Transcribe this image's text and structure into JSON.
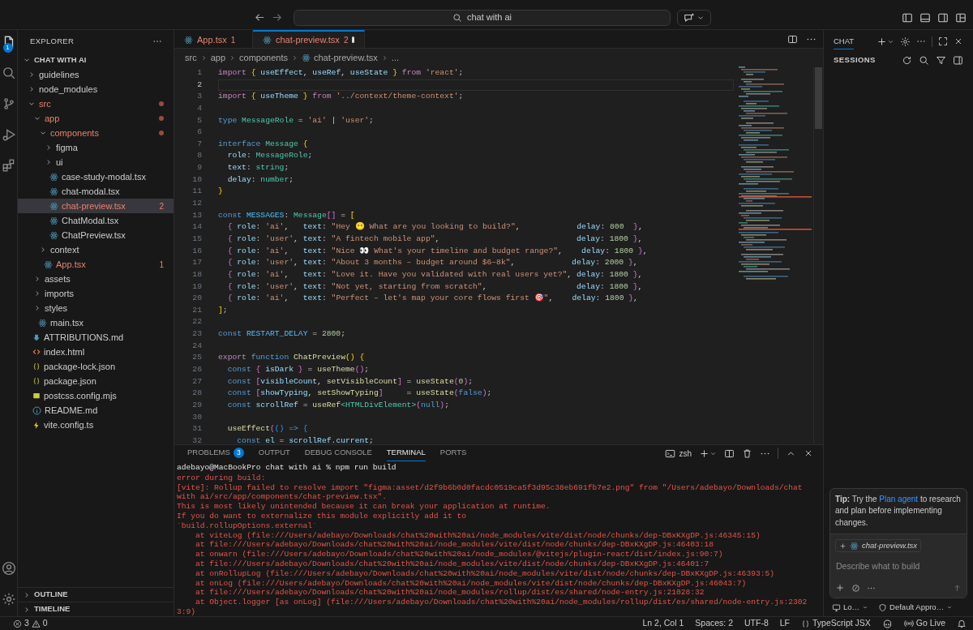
{
  "title_bar": {
    "search": "chat with ai"
  },
  "activity_bar": {
    "explorer_badge": "1"
  },
  "explorer": {
    "title": "EXPLORER",
    "root": "CHAT WITH AI",
    "items": [
      {
        "name": "guidelines",
        "kind": "folder",
        "expanded": false,
        "selected": false,
        "error": false
      },
      {
        "name": "node_modules",
        "kind": "folder",
        "expanded": false,
        "selected": false,
        "error": false
      },
      {
        "name": "src",
        "kind": "folder",
        "expanded": true,
        "selected": false,
        "error": true,
        "children": [
          {
            "name": "app",
            "kind": "folder",
            "expanded": true,
            "selected": false,
            "error": true,
            "children": [
              {
                "name": "components",
                "kind": "folder",
                "expanded": true,
                "selected": false,
                "error": true,
                "children": [
                  {
                    "name": "figma",
                    "kind": "folder",
                    "expanded": false,
                    "selected": false,
                    "error": false
                  },
                  {
                    "name": "ui",
                    "kind": "folder",
                    "expanded": false,
                    "selected": false,
                    "error": false
                  },
                  {
                    "name": "case-study-modal.tsx",
                    "kind": "react",
                    "selected": false,
                    "error": false
                  },
                  {
                    "name": "chat-modal.tsx",
                    "kind": "react",
                    "selected": false,
                    "error": false
                  },
                  {
                    "name": "chat-preview.tsx",
                    "kind": "react",
                    "selected": true,
                    "error": true,
                    "badge": "2"
                  },
                  {
                    "name": "ChatModal.tsx",
                    "kind": "react",
                    "selected": false,
                    "error": false
                  },
                  {
                    "name": "ChatPreview.tsx",
                    "kind": "react",
                    "selected": false,
                    "error": false
                  }
                ]
              },
              {
                "name": "context",
                "kind": "folder",
                "expanded": false,
                "selected": false,
                "error": false
              },
              {
                "name": "App.tsx",
                "kind": "react",
                "selected": false,
                "error": true,
                "badge": "1"
              }
            ]
          },
          {
            "name": "assets",
            "kind": "folder",
            "expanded": false,
            "selected": false,
            "error": false
          },
          {
            "name": "imports",
            "kind": "folder",
            "expanded": false,
            "selected": false,
            "error": false
          },
          {
            "name": "styles",
            "kind": "folder",
            "expanded": false,
            "selected": false,
            "error": false
          },
          {
            "name": "main.tsx",
            "kind": "react",
            "selected": false,
            "error": false
          }
        ]
      },
      {
        "name": "ATTRIBUTIONS.md",
        "kind": "markdown",
        "selected": false,
        "error": false
      },
      {
        "name": "index.html",
        "kind": "html",
        "selected": false,
        "error": false
      },
      {
        "name": "package-lock.json",
        "kind": "json",
        "selected": false,
        "error": false
      },
      {
        "name": "package.json",
        "kind": "json",
        "selected": false,
        "error": false
      },
      {
        "name": "postcss.config.mjs",
        "kind": "js",
        "selected": false,
        "error": false
      },
      {
        "name": "README.md",
        "kind": "info",
        "selected": false,
        "error": false
      },
      {
        "name": "vite.config.ts",
        "kind": "vite",
        "selected": false,
        "error": false
      }
    ],
    "sections": [
      "OUTLINE",
      "TIMELINE"
    ]
  },
  "tabs": [
    {
      "label": "App.tsx",
      "badge": "1",
      "error": true,
      "selected": false,
      "dirty": false
    },
    {
      "label": "chat-preview.tsx",
      "badge": "2",
      "error": true,
      "selected": true,
      "dirty": true
    }
  ],
  "breadcrumb": [
    {
      "label": "src",
      "kind": "folder"
    },
    {
      "label": "app",
      "kind": "folder"
    },
    {
      "label": "components",
      "kind": "folder"
    },
    {
      "label": "chat-preview.tsx",
      "kind": "react"
    },
    {
      "label": "...",
      "kind": "more"
    }
  ],
  "code": {
    "lines": [
      {
        "number": "1",
        "current": false,
        "tokens": [
          {
            "text": "import ",
            "kind": "kw"
          },
          {
            "text": "{",
            "kind": "b1"
          },
          {
            "text": " useEffect",
            "kind": "var"
          },
          {
            "text": ", ",
            "kind": "p"
          },
          {
            "text": "useRef",
            "kind": "var"
          },
          {
            "text": ", ",
            "kind": "p"
          },
          {
            "text": "useState",
            "kind": "var"
          },
          {
            "text": " }",
            "kind": "b1"
          },
          {
            "text": " from ",
            "kind": "kw"
          },
          {
            "text": "'react'",
            "kind": "str"
          },
          {
            "text": ";",
            "kind": "p"
          }
        ]
      },
      {
        "number": "2",
        "current": true
      },
      {
        "number": "3",
        "current": false,
        "tokens": [
          {
            "text": "import ",
            "kind": "kw"
          },
          {
            "text": "{",
            "kind": "b1"
          },
          {
            "text": " useTheme ",
            "kind": "var"
          },
          {
            "text": "}",
            "kind": "b1"
          },
          {
            "text": " from ",
            "kind": "kw"
          },
          {
            "text": "'../context/theme-context'",
            "kind": "str"
          },
          {
            "text": ";",
            "kind": "p"
          }
        ]
      },
      {
        "number": "4",
        "current": false
      },
      {
        "number": "5",
        "current": false,
        "tokens": [
          {
            "text": "type ",
            "kind": "decl"
          },
          {
            "text": "MessageRole",
            "kind": "type"
          },
          {
            "text": " = ",
            "kind": "p"
          },
          {
            "text": "'ai'",
            "kind": "str"
          },
          {
            "text": " | ",
            "kind": "p"
          },
          {
            "text": "'user'",
            "kind": "str"
          },
          {
            "text": ";",
            "kind": "p"
          }
        ]
      },
      {
        "number": "6",
        "current": false
      },
      {
        "number": "7",
        "current": false,
        "tokens": [
          {
            "text": "interface ",
            "kind": "decl"
          },
          {
            "text": "Message ",
            "kind": "type"
          },
          {
            "text": "{",
            "kind": "b1"
          }
        ]
      },
      {
        "number": "8",
        "current": false,
        "tokens": [
          {
            "text": "  role",
            "kind": "var"
          },
          {
            "text": ": ",
            "kind": "p"
          },
          {
            "text": "MessageRole",
            "kind": "type"
          },
          {
            "text": ";",
            "kind": "p"
          }
        ]
      },
      {
        "number": "9",
        "current": false,
        "tokens": [
          {
            "text": "  text",
            "kind": "var"
          },
          {
            "text": ": ",
            "kind": "p"
          },
          {
            "text": "string",
            "kind": "type"
          },
          {
            "text": ";",
            "kind": "p"
          }
        ]
      },
      {
        "number": "10",
        "current": false,
        "tokens": [
          {
            "text": "  delay",
            "kind": "var"
          },
          {
            "text": ": ",
            "kind": "p"
          },
          {
            "text": "number",
            "kind": "type"
          },
          {
            "text": ";",
            "kind": "p"
          }
        ]
      },
      {
        "number": "11",
        "current": false,
        "tokens": [
          {
            "text": "}",
            "kind": "b1"
          }
        ]
      },
      {
        "number": "12",
        "current": false
      },
      {
        "number": "13",
        "current": false,
        "tokens": [
          {
            "text": "const ",
            "kind": "decl"
          },
          {
            "text": "MESSAGES",
            "kind": "const"
          },
          {
            "text": ": ",
            "kind": "p"
          },
          {
            "text": "Message",
            "kind": "type"
          },
          {
            "text": "[]",
            "kind": "b2"
          },
          {
            "text": " = ",
            "kind": "p"
          },
          {
            "text": "[",
            "kind": "b1"
          }
        ]
      },
      {
        "number": "14",
        "current": false,
        "tokens": [
          {
            "text": "  {",
            "kind": "b2"
          },
          {
            "text": " role",
            "kind": "var"
          },
          {
            "text": ": ",
            "kind": "p"
          },
          {
            "text": "'ai'",
            "kind": "str"
          },
          {
            "text": ",   ",
            "kind": "p"
          },
          {
            "text": "text",
            "kind": "var"
          },
          {
            "text": ": ",
            "kind": "p"
          },
          {
            "text": "\"Hey 😶 What are you looking to build?\"",
            "kind": "str"
          },
          {
            "text": ",            ",
            "kind": "p"
          },
          {
            "text": "delay",
            "kind": "var"
          },
          {
            "text": ": ",
            "kind": "p"
          },
          {
            "text": "800",
            "kind": "num"
          },
          {
            "text": "  }",
            "kind": "b2"
          },
          {
            "text": ",",
            "kind": "p"
          }
        ]
      },
      {
        "number": "15",
        "current": false,
        "tokens": [
          {
            "text": "  {",
            "kind": "b2"
          },
          {
            "text": " role",
            "kind": "var"
          },
          {
            "text": ": ",
            "kind": "p"
          },
          {
            "text": "'user'",
            "kind": "str"
          },
          {
            "text": ", ",
            "kind": "p"
          },
          {
            "text": "text",
            "kind": "var"
          },
          {
            "text": ": ",
            "kind": "p"
          },
          {
            "text": "\"A fintech mobile app\"",
            "kind": "str"
          },
          {
            "text": ",                             ",
            "kind": "p"
          },
          {
            "text": "delay",
            "kind": "var"
          },
          {
            "text": ": ",
            "kind": "p"
          },
          {
            "text": "1800",
            "kind": "num"
          },
          {
            "text": " }",
            "kind": "b2"
          },
          {
            "text": ",",
            "kind": "p"
          }
        ]
      },
      {
        "number": "16",
        "current": false,
        "tokens": [
          {
            "text": "  {",
            "kind": "b2"
          },
          {
            "text": " role",
            "kind": "var"
          },
          {
            "text": ": ",
            "kind": "p"
          },
          {
            "text": "'ai'",
            "kind": "str"
          },
          {
            "text": ",   ",
            "kind": "p"
          },
          {
            "text": "text",
            "kind": "var"
          },
          {
            "text": ": ",
            "kind": "p"
          },
          {
            "text": "\"Nice 👀 What's your timeline and budget range?\"",
            "kind": "str"
          },
          {
            "text": ",    ",
            "kind": "p"
          },
          {
            "text": "delay",
            "kind": "var"
          },
          {
            "text": ": ",
            "kind": "p"
          },
          {
            "text": "1800",
            "kind": "num"
          },
          {
            "text": " }",
            "kind": "b2"
          },
          {
            "text": ",",
            "kind": "p"
          }
        ]
      },
      {
        "number": "17",
        "current": false,
        "tokens": [
          {
            "text": "  {",
            "kind": "b2"
          },
          {
            "text": " role",
            "kind": "var"
          },
          {
            "text": ": ",
            "kind": "p"
          },
          {
            "text": "'user'",
            "kind": "str"
          },
          {
            "text": ", ",
            "kind": "p"
          },
          {
            "text": "text",
            "kind": "var"
          },
          {
            "text": ": ",
            "kind": "p"
          },
          {
            "text": "\"About 3 months – budget around $6–8k\"",
            "kind": "str"
          },
          {
            "text": ",            ",
            "kind": "p"
          },
          {
            "text": "delay",
            "kind": "var"
          },
          {
            "text": ": ",
            "kind": "p"
          },
          {
            "text": "2000",
            "kind": "num"
          },
          {
            "text": " }",
            "kind": "b2"
          },
          {
            "text": ",",
            "kind": "p"
          }
        ]
      },
      {
        "number": "18",
        "current": false,
        "tokens": [
          {
            "text": "  {",
            "kind": "b2"
          },
          {
            "text": " role",
            "kind": "var"
          },
          {
            "text": ": ",
            "kind": "p"
          },
          {
            "text": "'ai'",
            "kind": "str"
          },
          {
            "text": ",   ",
            "kind": "p"
          },
          {
            "text": "text",
            "kind": "var"
          },
          {
            "text": ": ",
            "kind": "p"
          },
          {
            "text": "\"Love it. Have you validated with real users yet?\"",
            "kind": "str"
          },
          {
            "text": ", ",
            "kind": "p"
          },
          {
            "text": "delay",
            "kind": "var"
          },
          {
            "text": ": ",
            "kind": "p"
          },
          {
            "text": "1800",
            "kind": "num"
          },
          {
            "text": " }",
            "kind": "b2"
          },
          {
            "text": ",",
            "kind": "p"
          }
        ]
      },
      {
        "number": "19",
        "current": false,
        "tokens": [
          {
            "text": "  {",
            "kind": "b2"
          },
          {
            "text": " role",
            "kind": "var"
          },
          {
            "text": ": ",
            "kind": "p"
          },
          {
            "text": "'user'",
            "kind": "str"
          },
          {
            "text": ", ",
            "kind": "p"
          },
          {
            "text": "text",
            "kind": "var"
          },
          {
            "text": ": ",
            "kind": "p"
          },
          {
            "text": "\"Not yet, starting from scratch\"",
            "kind": "str"
          },
          {
            "text": ",                   ",
            "kind": "p"
          },
          {
            "text": "delay",
            "kind": "var"
          },
          {
            "text": ": ",
            "kind": "p"
          },
          {
            "text": "1800",
            "kind": "num"
          },
          {
            "text": " }",
            "kind": "b2"
          },
          {
            "text": ",",
            "kind": "p"
          }
        ]
      },
      {
        "number": "20",
        "current": false,
        "tokens": [
          {
            "text": "  {",
            "kind": "b2"
          },
          {
            "text": " role",
            "kind": "var"
          },
          {
            "text": ": ",
            "kind": "p"
          },
          {
            "text": "'ai'",
            "kind": "str"
          },
          {
            "text": ",   ",
            "kind": "p"
          },
          {
            "text": "text",
            "kind": "var"
          },
          {
            "text": ": ",
            "kind": "p"
          },
          {
            "text": "\"Perfect – let's map your core flows first 🎯\"",
            "kind": "str"
          },
          {
            "text": ",    ",
            "kind": "p"
          },
          {
            "text": "delay",
            "kind": "var"
          },
          {
            "text": ": ",
            "kind": "p"
          },
          {
            "text": "1800",
            "kind": "num"
          },
          {
            "text": " }",
            "kind": "b2"
          },
          {
            "text": ",",
            "kind": "p"
          }
        ]
      },
      {
        "number": "21",
        "current": false,
        "tokens": [
          {
            "text": "]",
            "kind": "b1"
          },
          {
            "text": ";",
            "kind": "p"
          }
        ]
      },
      {
        "number": "22",
        "current": false
      },
      {
        "number": "23",
        "current": false,
        "tokens": [
          {
            "text": "const ",
            "kind": "decl"
          },
          {
            "text": "RESTART_DELAY",
            "kind": "const"
          },
          {
            "text": " = ",
            "kind": "p"
          },
          {
            "text": "2800",
            "kind": "num"
          },
          {
            "text": ";",
            "kind": "p"
          }
        ]
      },
      {
        "number": "24",
        "current": false
      },
      {
        "number": "25",
        "current": false,
        "tokens": [
          {
            "text": "export ",
            "kind": "kw"
          },
          {
            "text": "function ",
            "kind": "decl"
          },
          {
            "text": "ChatPreview",
            "kind": "fn"
          },
          {
            "text": "()",
            "kind": "b1"
          },
          {
            "text": " {",
            "kind": "b1"
          }
        ]
      },
      {
        "number": "26",
        "current": false,
        "tokens": [
          {
            "text": "  const ",
            "kind": "decl"
          },
          {
            "text": "{",
            "kind": "b2"
          },
          {
            "text": " isDark ",
            "kind": "var"
          },
          {
            "text": "}",
            "kind": "b2"
          },
          {
            "text": " = ",
            "kind": "p"
          },
          {
            "text": "useTheme",
            "kind": "fn"
          },
          {
            "text": "()",
            "kind": "b2"
          },
          {
            "text": ";",
            "kind": "p"
          }
        ]
      },
      {
        "number": "27",
        "current": false,
        "tokens": [
          {
            "text": "  const ",
            "kind": "decl"
          },
          {
            "text": "[",
            "kind": "b2"
          },
          {
            "text": "visibleCount",
            "kind": "var"
          },
          {
            "text": ", ",
            "kind": "p"
          },
          {
            "text": "setVisibleCount",
            "kind": "fn"
          },
          {
            "text": "]",
            "kind": "b2"
          },
          {
            "text": " = ",
            "kind": "p"
          },
          {
            "text": "useState",
            "kind": "fn"
          },
          {
            "text": "(",
            "kind": "b2"
          },
          {
            "text": "0",
            "kind": "num"
          },
          {
            "text": ")",
            "kind": "b2"
          },
          {
            "text": ";",
            "kind": "p"
          }
        ]
      },
      {
        "number": "28",
        "current": false,
        "tokens": [
          {
            "text": "  const ",
            "kind": "decl"
          },
          {
            "text": "[",
            "kind": "b2"
          },
          {
            "text": "showTyping",
            "kind": "var"
          },
          {
            "text": ", ",
            "kind": "p"
          },
          {
            "text": "setShowTyping",
            "kind": "fn"
          },
          {
            "text": "]",
            "kind": "b2"
          },
          {
            "text": "     = ",
            "kind": "p"
          },
          {
            "text": "useState",
            "kind": "fn"
          },
          {
            "text": "(",
            "kind": "b2"
          },
          {
            "text": "false",
            "kind": "decl"
          },
          {
            "text": ")",
            "kind": "b2"
          },
          {
            "text": ";",
            "kind": "p"
          }
        ]
      },
      {
        "number": "29",
        "current": false,
        "tokens": [
          {
            "text": "  const ",
            "kind": "decl"
          },
          {
            "text": "scrollRef",
            "kind": "var"
          },
          {
            "text": " = ",
            "kind": "p"
          },
          {
            "text": "useRef",
            "kind": "fn"
          },
          {
            "text": "<HTMLDivElement>",
            "kind": "type"
          },
          {
            "text": "(",
            "kind": "b2"
          },
          {
            "text": "null",
            "kind": "decl"
          },
          {
            "text": ")",
            "kind": "b2"
          },
          {
            "text": ";",
            "kind": "p"
          }
        ]
      },
      {
        "number": "30",
        "current": false
      },
      {
        "number": "31",
        "current": false,
        "tokens": [
          {
            "text": "  useEffect",
            "kind": "fn"
          },
          {
            "text": "(",
            "kind": "b2"
          },
          {
            "text": "()",
            "kind": "b3"
          },
          {
            "text": " => ",
            "kind": "decl"
          },
          {
            "text": "{",
            "kind": "b3"
          }
        ]
      },
      {
        "number": "32",
        "current": false,
        "tokens": [
          {
            "text": "    const ",
            "kind": "decl"
          },
          {
            "text": "el",
            "kind": "var"
          },
          {
            "text": " = ",
            "kind": "p"
          },
          {
            "text": "scrollRef",
            "kind": "var"
          },
          {
            "text": ".",
            "kind": "p"
          },
          {
            "text": "current",
            "kind": "var"
          },
          {
            "text": ";",
            "kind": "p"
          }
        ]
      }
    ]
  },
  "panel": {
    "tabs": [
      {
        "label": "PROBLEMS",
        "badge": "3",
        "selected": false
      },
      {
        "label": "OUTPUT",
        "selected": false
      },
      {
        "label": "DEBUG CONSOLE",
        "selected": false
      },
      {
        "label": "TERMINAL",
        "selected": true
      },
      {
        "label": "PORTS",
        "selected": false
      }
    ],
    "shell": "zsh",
    "terminal": [
      {
        "kind": "prompt",
        "text": "adebayo@MacBookPro chat with ai % npm run build"
      },
      {
        "kind": "error",
        "text": "error during build:"
      },
      {
        "kind": "error",
        "text": "[vite]: Rollup failed to resolve import \"figma:asset/d2f9b6b0d0facdc0519ca5f3d95c38eb691fb7e2.png\" from \"/Users/adebayo/Downloads/chat"
      },
      {
        "kind": "error",
        "text": "with ai/src/app/components/chat-preview.tsx\"."
      },
      {
        "kind": "error",
        "text": "This is most likely unintended because it can break your application at runtime."
      },
      {
        "kind": "error",
        "text": "If you do want to externalize this module explicitly add it to"
      },
      {
        "kind": "error",
        "text": "`build.rollupOptions.external`"
      },
      {
        "kind": "error",
        "text": "    at viteLog (file:///Users/adebayo/Downloads/chat%20with%20ai/node_modules/vite/dist/node/chunks/dep-DBxKXgDP.js:46345:15)"
      },
      {
        "kind": "error",
        "text": "    at file:///Users/adebayo/Downloads/chat%20with%20ai/node_modules/vite/dist/node/chunks/dep-DBxKXgDP.js:46403:18"
      },
      {
        "kind": "error",
        "text": "    at onwarn (file:///Users/adebayo/Downloads/chat%20with%20ai/node_modules/@vitejs/plugin-react/dist/index.js:90:7)"
      },
      {
        "kind": "error",
        "text": "    at file:///Users/adebayo/Downloads/chat%20with%20ai/node_modules/vite/dist/node/chunks/dep-DBxKXgDP.js:46401:7"
      },
      {
        "kind": "error",
        "text": "    at onRollupLog (file:///Users/adebayo/Downloads/chat%20with%20ai/node_modules/vite/dist/node/chunks/dep-DBxKXgDP.js:46393:5)"
      },
      {
        "kind": "error",
        "text": "    at onLog (file:///Users/adebayo/Downloads/chat%20with%20ai/node_modules/vite/dist/node/chunks/dep-DBxKXgDP.js:46043:7)"
      },
      {
        "kind": "error",
        "text": "    at file:///Users/adebayo/Downloads/chat%20with%20ai/node_modules/rollup/dist/es/shared/node-entry.js:21028:32"
      },
      {
        "kind": "error",
        "text": "    at Object.logger [as onLog] (file:///Users/adebayo/Downloads/chat%20with%20ai/node_modules/rollup/dist/es/shared/node-entry.js:2302"
      },
      {
        "kind": "error",
        "text": "3:9)"
      }
    ]
  },
  "chat": {
    "tab": "CHAT",
    "section": "SESSIONS",
    "tip": {
      "lead": "**Tip:** Try the",
      "link": "Plan agent",
      "rest": "to research and plan before implementing changes."
    },
    "attachment": "chat-preview.tsx",
    "placeholder": "Describe what to build",
    "target": "Lo…",
    "approvals": "Default Appro…"
  },
  "status_bar": {
    "errors": "3",
    "warnings": "0",
    "position": "Ln 2, Col 1",
    "spaces": "Spaces: 2",
    "encoding": "UTF-8",
    "eol": "LF",
    "language": "TypeScript JSX",
    "live": "Go Live"
  }
}
